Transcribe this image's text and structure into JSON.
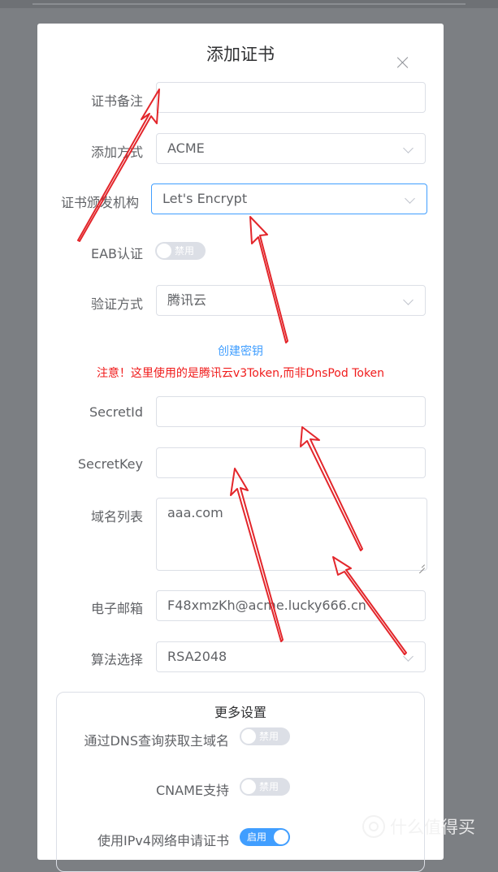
{
  "dialog": {
    "title": "添加证书",
    "close_icon": "close-icon"
  },
  "form": {
    "cert_note": {
      "label": "证书备注",
      "value": ""
    },
    "add_method": {
      "label": "添加方式",
      "value": "ACME"
    },
    "issuer": {
      "label": "证书颁发机构",
      "value": "Let's Encrypt"
    },
    "eab": {
      "label": "EAB认证",
      "switch_text": "禁用",
      "enabled": false
    },
    "verify_method": {
      "label": "验证方式",
      "value": "腾讯云"
    },
    "create_key_link": "创建密钥",
    "notice": "注意！这里使用的是腾讯云v3Token,而非DnsPod Token",
    "secret_id": {
      "label": "SecretId",
      "value": ""
    },
    "secret_key": {
      "label": "SecretKey",
      "value": ""
    },
    "domain_list": {
      "label": "域名列表",
      "value": "aaa.com"
    },
    "email": {
      "label": "电子邮箱",
      "value": "F48xmzKh@acme.lucky666.cn"
    },
    "algorithm": {
      "label": "算法选择",
      "value": "RSA2048"
    }
  },
  "more_settings": {
    "title": "更多设置",
    "dns_lookup": {
      "label": "通过DNS查询获取主域名",
      "switch_text": "禁用",
      "enabled": false
    },
    "cname": {
      "label": "CNAME支持",
      "switch_text": "禁用",
      "enabled": false
    },
    "ipv4": {
      "label": "使用IPv4网络申请证书",
      "switch_text": "启用",
      "enabled": true
    }
  },
  "colors": {
    "accent": "#409eff",
    "annotation_red": "#e3262b",
    "notice_red": "#f01c1c"
  },
  "watermark": {
    "text": "什么值得买",
    "icon": "zhi-logo-icon"
  }
}
